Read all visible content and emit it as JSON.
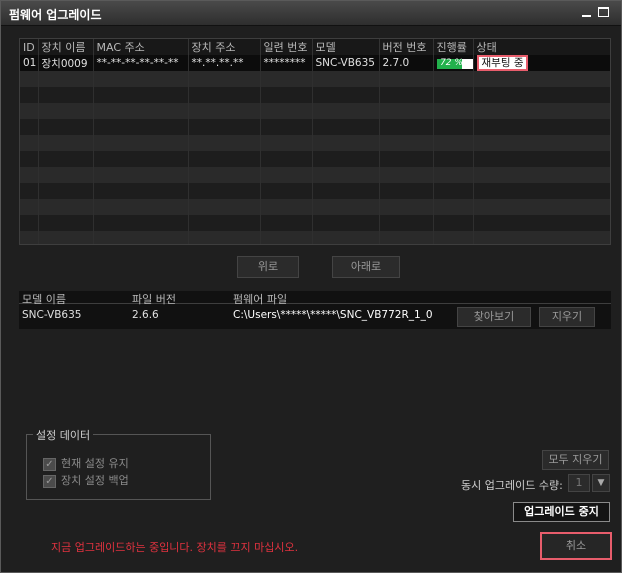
{
  "window": {
    "title": "펌웨어 업그레이드",
    "min_icon": "minimize-icon",
    "max_icon": "maximize-icon"
  },
  "device_table": {
    "columns": [
      "ID",
      "장치 이름",
      "MAC 주소",
      "장치 주소",
      "일련 번호",
      "모델",
      "버전 번호",
      "진행률",
      "상태"
    ],
    "rows": [
      {
        "id": "01",
        "name": "장치0009",
        "mac": "**-**-**-**-**-**",
        "address": "**.**.**.**",
        "serial": "********",
        "model": "SNC-VB635",
        "version": "2.7.0",
        "progress_text": "72 %",
        "progress_fraction": 0.72,
        "status": "재부팅 중"
      }
    ],
    "empty_row_count": 11
  },
  "nav": {
    "up_label": "위로",
    "down_label": "아래로"
  },
  "firmware": {
    "headers": [
      "모델 이름",
      "파일 버전",
      "펌웨어 파일"
    ],
    "model": "SNC-VB635",
    "file_version": "2.6.6",
    "file_path": "C:\\Users\\*****\\*****\\SNC_VB772R_1_0",
    "browse_label": "찾아보기",
    "clear_label": "지우기"
  },
  "settings": {
    "legend": "설정 데이터",
    "keep_label": "현재 설정 유지",
    "keep_checked": true,
    "backup_label": "장치 설정 백업",
    "backup_checked": true
  },
  "controls": {
    "clear_all_label": "모두 지우기",
    "concurrent_label": "동시 업그레이드 수량:",
    "concurrent_value": "1",
    "stop_label": "업그레이드 중지",
    "cancel_label": "취소"
  },
  "warning": "지금 업그레이드하는 중입니다. 장치를 끄지 마십시오.",
  "colors": {
    "progress_green": "#22b14c",
    "highlight_border": "#e85d6c",
    "warning_red": "#e0323f"
  }
}
